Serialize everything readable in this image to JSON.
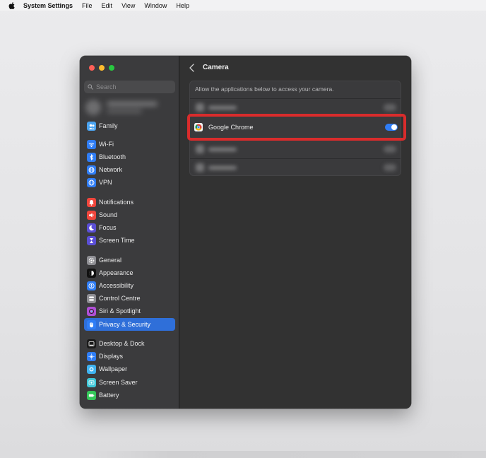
{
  "menubar": {
    "app_name": "System Settings",
    "menus": [
      "File",
      "Edit",
      "View",
      "Window",
      "Help"
    ]
  },
  "sidebar": {
    "search_placeholder": "Search",
    "items": [
      {
        "label": "Family",
        "icon": "family-icon",
        "color": "#4aa3f0"
      },
      {
        "label": "Wi-Fi",
        "icon": "wifi-icon",
        "color": "#2f7df6"
      },
      {
        "label": "Bluetooth",
        "icon": "bluetooth-icon",
        "color": "#2f7df6"
      },
      {
        "label": "Network",
        "icon": "network-icon",
        "color": "#2f7df6"
      },
      {
        "label": "VPN",
        "icon": "vpn-icon",
        "color": "#2f7df6"
      },
      {
        "label": "Notifications",
        "icon": "bell-icon",
        "color": "#f0463c"
      },
      {
        "label": "Sound",
        "icon": "speaker-icon",
        "color": "#f0463c"
      },
      {
        "label": "Focus",
        "icon": "moon-icon",
        "color": "#5b4fd6"
      },
      {
        "label": "Screen Time",
        "icon": "hourglass-icon",
        "color": "#5b4fd6"
      },
      {
        "label": "General",
        "icon": "gear-icon",
        "color": "#8e8e93"
      },
      {
        "label": "Appearance",
        "icon": "appearance-icon",
        "color": "#111111"
      },
      {
        "label": "Accessibility",
        "icon": "accessibility-icon",
        "color": "#2f7df6"
      },
      {
        "label": "Control Centre",
        "icon": "control-centre-icon",
        "color": "#8e8e93"
      },
      {
        "label": "Siri & Spotlight",
        "icon": "siri-icon",
        "color": "#b04fd6"
      },
      {
        "label": "Privacy & Security",
        "icon": "hand-icon",
        "color": "#2f7df6",
        "selected": true
      },
      {
        "label": "Desktop & Dock",
        "icon": "dock-icon",
        "color": "#1a1a1a"
      },
      {
        "label": "Displays",
        "icon": "sun-icon",
        "color": "#2f7df6"
      },
      {
        "label": "Wallpaper",
        "icon": "wallpaper-icon",
        "color": "#3fb3f0"
      },
      {
        "label": "Screen Saver",
        "icon": "screen-saver-icon",
        "color": "#3fc7d8"
      },
      {
        "label": "Battery",
        "icon": "battery-icon",
        "color": "#34c759"
      }
    ]
  },
  "main": {
    "title": "Camera",
    "description": "Allow the applications below to access your camera.",
    "apps": [
      {
        "label": "Google Chrome",
        "enabled": true
      }
    ]
  },
  "colors": {
    "accent": "#2f7df6",
    "highlight": "#d92c2c"
  }
}
